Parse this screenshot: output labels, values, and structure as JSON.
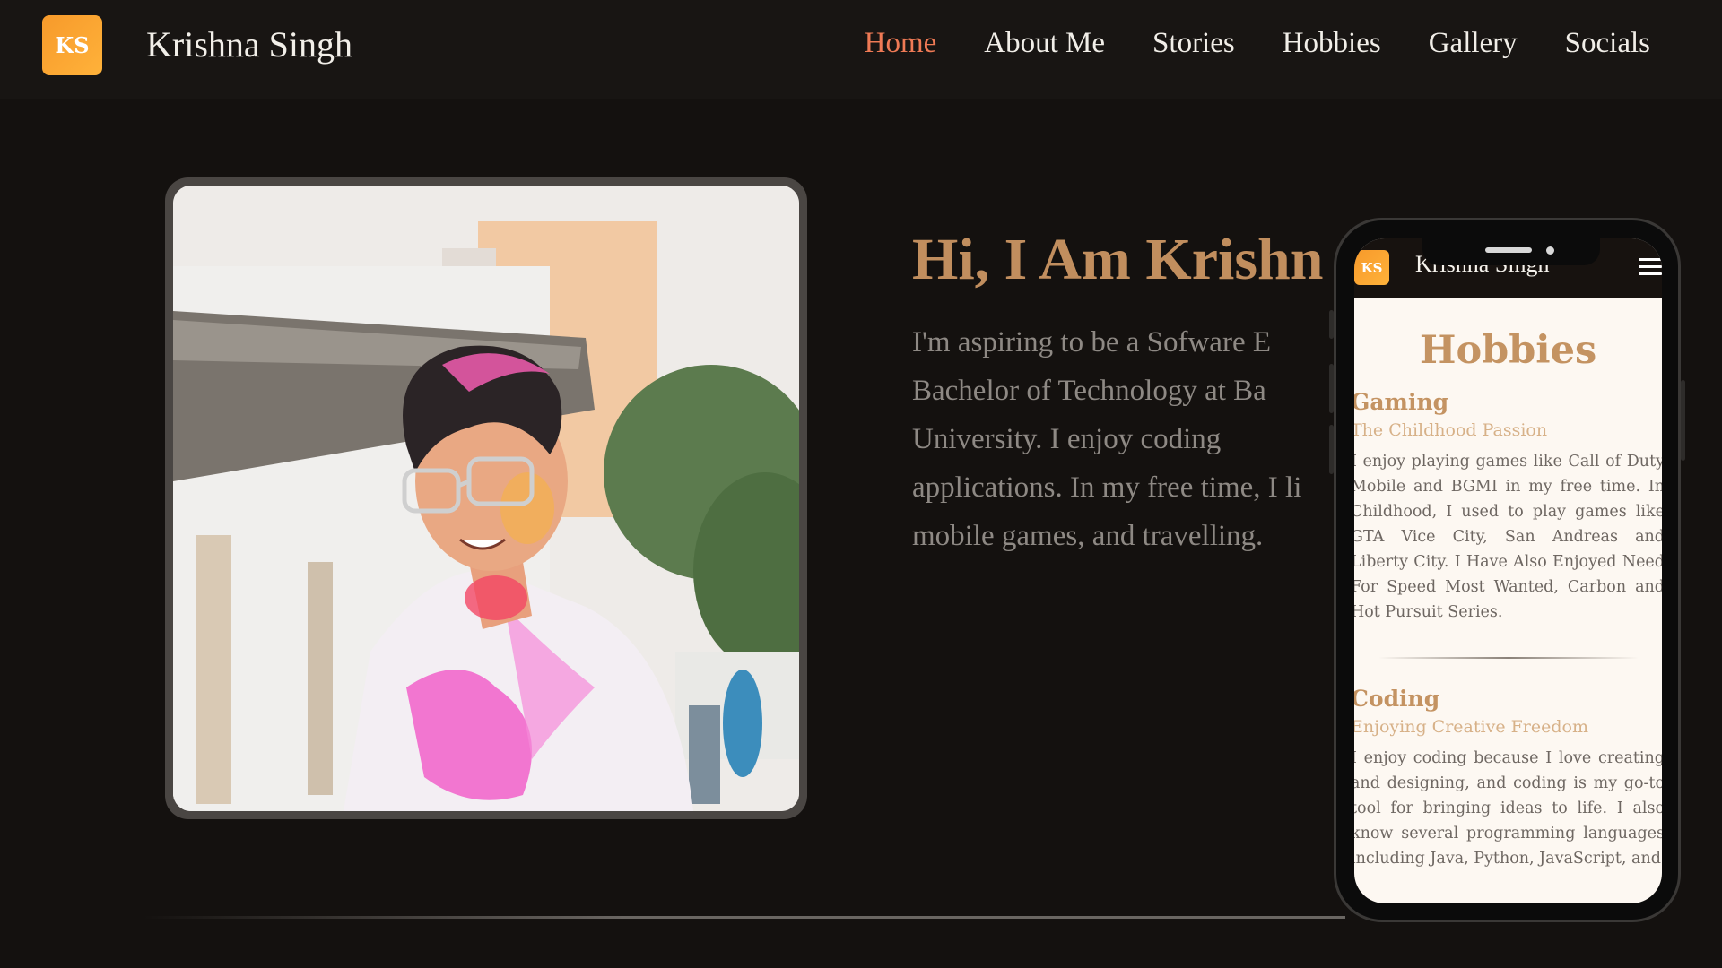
{
  "nav": {
    "logo_text": "KS",
    "brand": "Krishna Singh",
    "links": [
      "Home",
      "About Me",
      "Stories",
      "Hobbies",
      "Gallery",
      "Socials"
    ],
    "active_link": "Home"
  },
  "hero": {
    "title": "Hi, I Am Krishn",
    "lines": [
      "I'm aspiring to be a Sofware E",
      "Bachelor of Technology at Ba",
      "University. I enjoy coding",
      "applications. In my free time, I li",
      "mobile games, and travelling."
    ]
  },
  "phone": {
    "logo_text": "KS",
    "brand": "Krishna Singh",
    "section_title": "Hobbies",
    "hobbies": [
      {
        "title": "Gaming",
        "subtitle": "The Childhood Passion",
        "body": "I enjoy playing games like Call of Duty Mobile and BGMI in my free time. In Childhood, I used to play games like GTA Vice City, San Andreas and Liberty City. I Have Also Enjoyed Need For Speed Most Wanted, Carbon and Hot Pursuit Series."
      },
      {
        "title": "Coding",
        "subtitle": "Enjoying Creative Freedom",
        "body": "I enjoy coding because I love creating and designing, and coding is my go-to tool for bringing ideas to life. I also know several programming languages including Java, Python, JavaScript, and"
      }
    ]
  },
  "colors": {
    "background": "#14110f",
    "accent": "#ef7a55",
    "heading": "#c18e5e",
    "logo": "#f79a2b"
  }
}
